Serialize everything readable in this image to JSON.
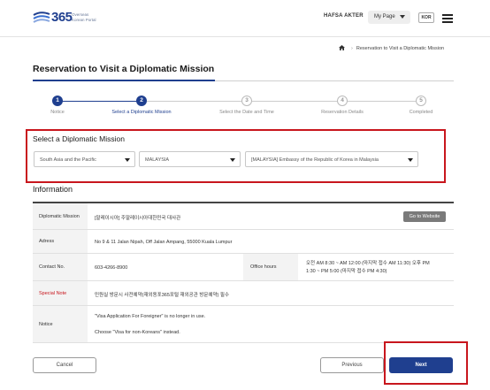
{
  "header": {
    "logo_number": "365",
    "logo_subtitle_line1": "Overseas",
    "logo_subtitle_line2": "Korean Portal",
    "user_name": "HAFSA AKTER",
    "mypage_label": "My Page",
    "lang_label": "KOR"
  },
  "breadcrumb": {
    "current": "Reservation to Visit a Diplomatic Mission"
  },
  "page": {
    "title": "Reservation to Visit a Diplomatic Mission"
  },
  "stepper": {
    "steps": [
      {
        "num": "1",
        "label": "Notice",
        "state": "done"
      },
      {
        "num": "2",
        "label": "Select a Diplomatic Mission",
        "state": "active"
      },
      {
        "num": "3",
        "label": "Select the Date and Time",
        "state": "todo"
      },
      {
        "num": "4",
        "label": "Reservation Details",
        "state": "todo"
      },
      {
        "num": "5",
        "label": "Completed",
        "state": "todo"
      }
    ]
  },
  "select_mission": {
    "title": "Select a Diplomatic Mission",
    "region": "South Asia and the Pacific",
    "country": "MALAYSIA",
    "mission": "[MALAYSIA] Embassy of the Republic of Korea in Malaysia"
  },
  "info": {
    "title": "Information",
    "diplomatic_mission_label": "Diplomatic Mission",
    "diplomatic_mission_value": "[말레이시아] 주말레이시아대한민국 대사관",
    "goto_website": "Go to Website",
    "address_label": "Adress",
    "address_value": "No 9 & 11 Jalan Nipah, Off Jalan Ampang, 55000 Kuala Lumpur",
    "contact_label": "Contact No.",
    "contact_value": "603-4266-8900",
    "office_hours_label": "Office hours",
    "office_hours_line1": "오전 AM 8:30 ~ AM 12:00 (마지막 접수 AM 11:30) 오후 PM",
    "office_hours_line2": "1:30 ~ PM 5:00 (마지막 접수 PM 4:30)",
    "special_note_label": "Special Note",
    "special_note_value": "민원실 방문시 사전예약(재외동포365포털 재외공관 방문예약) 필수",
    "notice_label": "Notice",
    "notice_line1": "\"Visa Application For Foreigner\" is no longer in use.",
    "notice_line2": "Choose \"Visa for non-Koreans\" instead."
  },
  "buttons": {
    "cancel": "Cancel",
    "previous": "Previous",
    "next": "Next"
  },
  "colors": {
    "brand": "#1f3f8f",
    "highlight": "#c8161d"
  }
}
